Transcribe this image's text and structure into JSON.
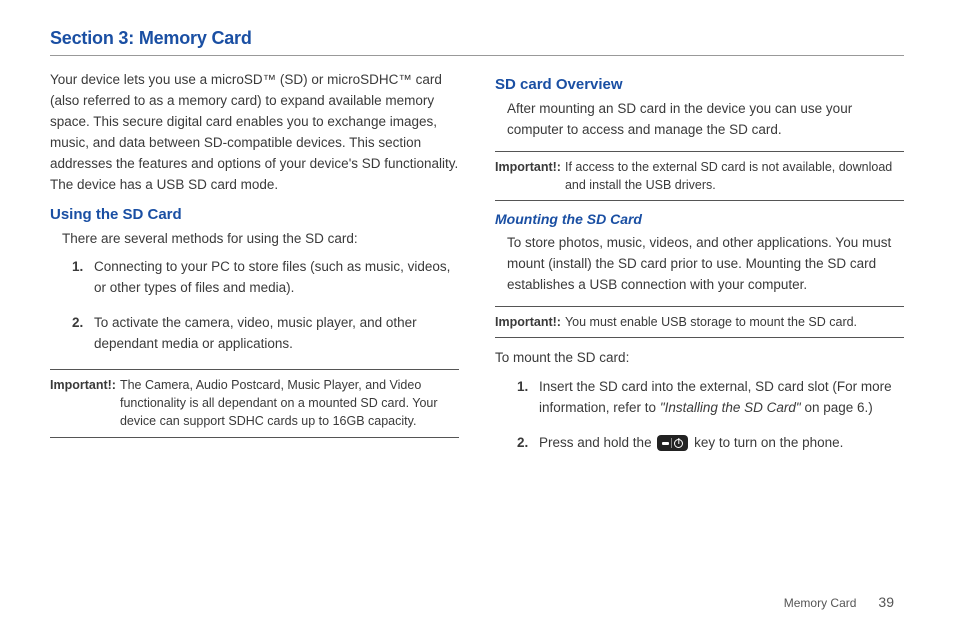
{
  "section_title": "Section 3: Memory Card",
  "left": {
    "intro": "Your device lets you use a microSD™ (SD) or microSDHC™ card (also referred to as a memory card) to expand available memory space. This secure digital card enables you to exchange images, music, and data between SD-compatible devices. This section addresses the features and options of your device's SD functionality. The device has a USB SD card mode.",
    "using_heading": "Using the SD Card",
    "using_intro": "There are several methods for using the SD card:",
    "using_items": [
      "Connecting to your PC to store files (such as music, videos, or other types of files and media).",
      "To activate the camera, video, music player, and other dependant media or applications."
    ],
    "important_label": "Important!:",
    "important_text": "The Camera, Audio Postcard, Music Player, and Video functionality is all dependant on a mounted SD card. Your device can support SDHC cards up to 16GB capacity."
  },
  "right": {
    "overview_heading": "SD card Overview",
    "overview_text": "After mounting an SD card in the device you can use your computer to access and manage the SD card.",
    "important1_label": "Important!:",
    "important1_text": "If access to the external SD card is not available, download and install the USB drivers.",
    "mounting_heading": "Mounting the SD Card",
    "mounting_text": "To store photos, music, videos, and other applications. You must mount (install) the SD card prior to use. Mounting the SD card establishes a USB connection with your computer.",
    "important2_label": "Important!:",
    "important2_text": "You must enable USB storage to mount the SD card.",
    "mount_intro": "To mount the SD card:",
    "mount_items": {
      "item1_a": "Insert the SD card into the external, SD card slot (For more information, refer to ",
      "item1_ref": "\"Installing the SD Card\"",
      "item1_b": " on page 6.)",
      "item2_a": "Press and hold the ",
      "item2_b": " key to turn on the phone."
    }
  },
  "footer": {
    "label": "Memory Card",
    "page": "39"
  }
}
